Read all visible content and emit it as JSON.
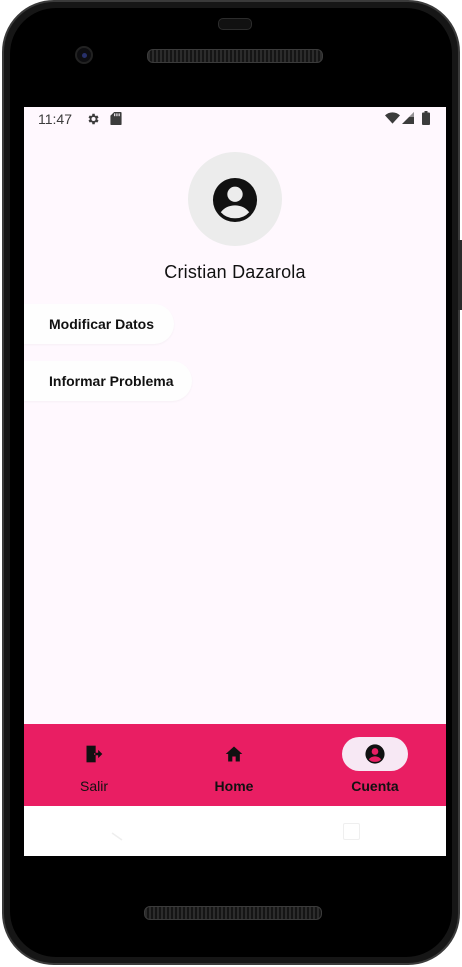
{
  "status_bar": {
    "time": "11:47",
    "icons": [
      "gear-icon",
      "sd-card-icon",
      "wifi-icon",
      "signal-icon",
      "battery-icon"
    ]
  },
  "profile": {
    "avatar_icon": "account-circle-icon",
    "name": "Cristian Dazarola"
  },
  "actions": {
    "modificar_label": "Modificar Datos",
    "informar_label": "Informar Problema"
  },
  "bottom_nav": {
    "items": [
      {
        "label": "Salir",
        "icon": "exit-icon",
        "active": false
      },
      {
        "label": "Home",
        "icon": "home-icon",
        "active": false
      },
      {
        "label": "Cuenta",
        "icon": "account-circle-icon",
        "active": true
      }
    ],
    "background_color": "#e91e63",
    "active_pill_color": "#f7e8f4"
  },
  "colors": {
    "screen_background": "#fff8fe",
    "avatar_background": "#ececec"
  }
}
